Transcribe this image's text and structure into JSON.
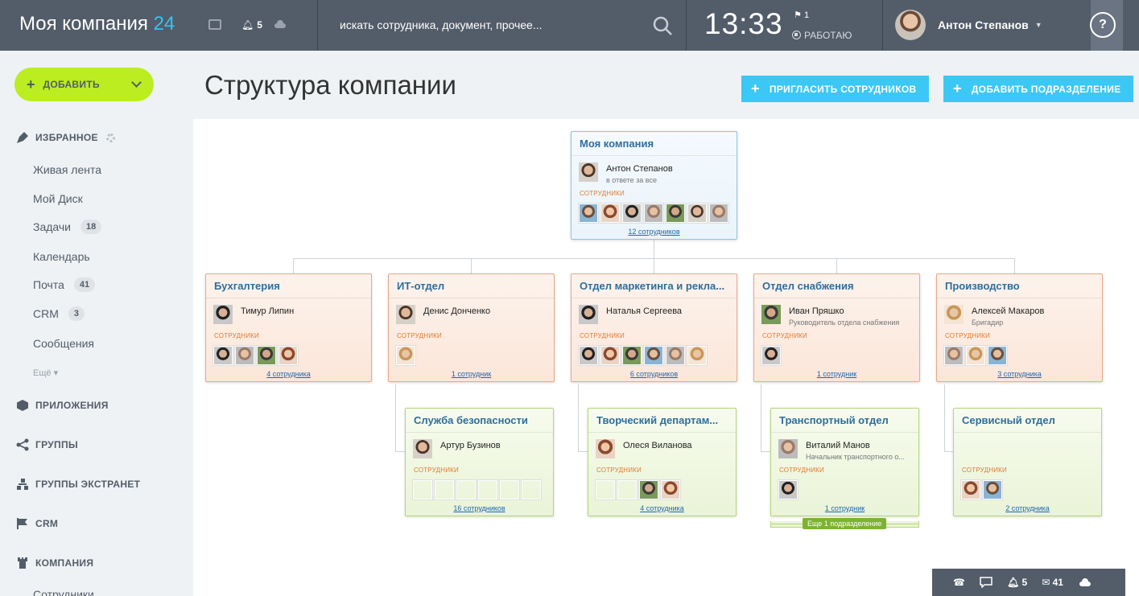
{
  "header": {
    "logo_text": "Моя компания",
    "logo_num": "24",
    "notifications_count": "5",
    "search_placeholder": "искать сотрудника, документ, прочее...",
    "clock": "13:33",
    "flag_count": "1",
    "work_status": "РАБОТАЮ",
    "user_name": "Антон Степанов",
    "help": "?"
  },
  "sidebar": {
    "add_label": "ДОБАВИТЬ",
    "favorites_label": "ИЗБРАННОЕ",
    "items": [
      {
        "label": "Живая лента",
        "badge": ""
      },
      {
        "label": "Мой Диск",
        "badge": ""
      },
      {
        "label": "Задачи",
        "badge": "18"
      },
      {
        "label": "Календарь",
        "badge": ""
      },
      {
        "label": "Почта",
        "badge": "41"
      },
      {
        "label": "CRM",
        "badge": "3"
      },
      {
        "label": "Сообщения",
        "badge": ""
      }
    ],
    "more_label": "Ещё",
    "sections": [
      {
        "label": "ПРИЛОЖЕНИЯ"
      },
      {
        "label": "ГРУППЫ"
      },
      {
        "label": "ГРУППЫ ЭКСТРАНЕТ"
      },
      {
        "label": "CRM"
      },
      {
        "label": "КОМПАНИЯ"
      }
    ],
    "last_item": "Сотрудники"
  },
  "page": {
    "title": "Структура компании",
    "invite_label": "ПРИГЛАСИТЬ СОТРУДНИКОВ",
    "add_dept_label": "ДОБАВИТЬ ПОДРАЗДЕЛЕНИЕ"
  },
  "departments": [
    {
      "title": "Моя компания",
      "head": "Антон Степанов",
      "head_pos": "в ответе за все",
      "employees_label": "СОТРУДНИКИ",
      "count": "12 сотрудников"
    },
    {
      "title": "Бухгалтерия",
      "head": "Тимур Липин",
      "head_pos": "",
      "employees_label": "СОТРУДНИКИ",
      "count": "4 сотрудника"
    },
    {
      "title": "ИТ-отдел",
      "head": "Денис Донченко",
      "head_pos": "",
      "employees_label": "СОТРУДНИКИ",
      "count": "1 сотрудник"
    },
    {
      "title": "Отдел маркетинга и рекла...",
      "head": "Наталья Сергеева",
      "head_pos": "",
      "employees_label": "СОТРУДНИКИ",
      "count": "6 сотрудников"
    },
    {
      "title": "Отдел снабжения",
      "head": "Иван Пряшко",
      "head_pos": "Руководитель отдела снабжения",
      "employees_label": "СОТРУДНИКИ",
      "count": "1 сотрудник"
    },
    {
      "title": "Производство",
      "head": "Алексей Макаров",
      "head_pos": "Бригадир",
      "employees_label": "СОТРУДНИКИ",
      "count": "3 сотрудника"
    },
    {
      "title": "Служба безопасности",
      "head": "Артур Бузинов",
      "head_pos": "",
      "employees_label": "СОТРУДНИКИ",
      "count": "16 сотрудников"
    },
    {
      "title": "Творческий департам...",
      "head": "Олеся Виланова",
      "head_pos": "",
      "employees_label": "СОТРУДНИКИ",
      "count": "4 сотрудника"
    },
    {
      "title": "Транспортный отдел",
      "head": "Виталий Манов",
      "head_pos": "Начальник транспортного о...",
      "employees_label": "СОТРУДНИКИ",
      "count": "1 сотрудник"
    },
    {
      "title": "Сервисный отдел",
      "head": "",
      "head_pos": "",
      "employees_label": "СОТРУДНИКИ",
      "count": "2 сотрудника"
    }
  ],
  "sub_badge": "Еще 1 подразделение",
  "bottom_bar": {
    "notifications": "5",
    "mail": "41"
  }
}
